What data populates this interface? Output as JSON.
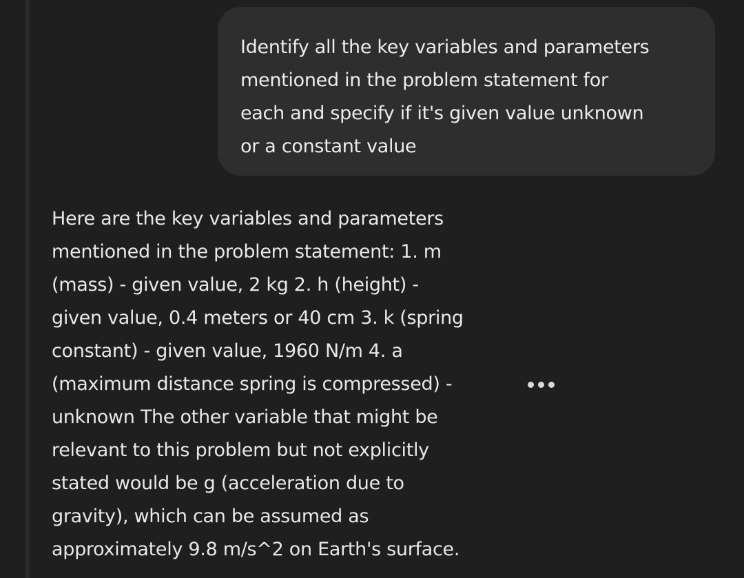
{
  "conversation": {
    "user_message": "Identify all the key variables and parameters\nmentioned in the problem statement for\neach and specify if it's given value unknown\nor a constant value",
    "assistant_message": "Here are the key variables and parameters\nmentioned in the problem statement: 1. m\n(mass) - given value, 2 kg 2. h (height) -\ngiven value, 0.4 meters or 40 cm 3. k (spring\nconstant) - given value, 1960 N/m 4. a\n(maximum distance spring is compressed) -\nunknown The other variable that might be\nrelevant to this problem but not explicitly\nstated would be g (acceleration due to\ngravity), which can be assumed as\napproximately 9.8 m/s^2 on Earth's surface."
  },
  "icons": {
    "more": "more-options-icon"
  },
  "colors": {
    "background": "#1f1f1f",
    "bubble": "#2e2e2e",
    "text": "#e8e8e8"
  }
}
